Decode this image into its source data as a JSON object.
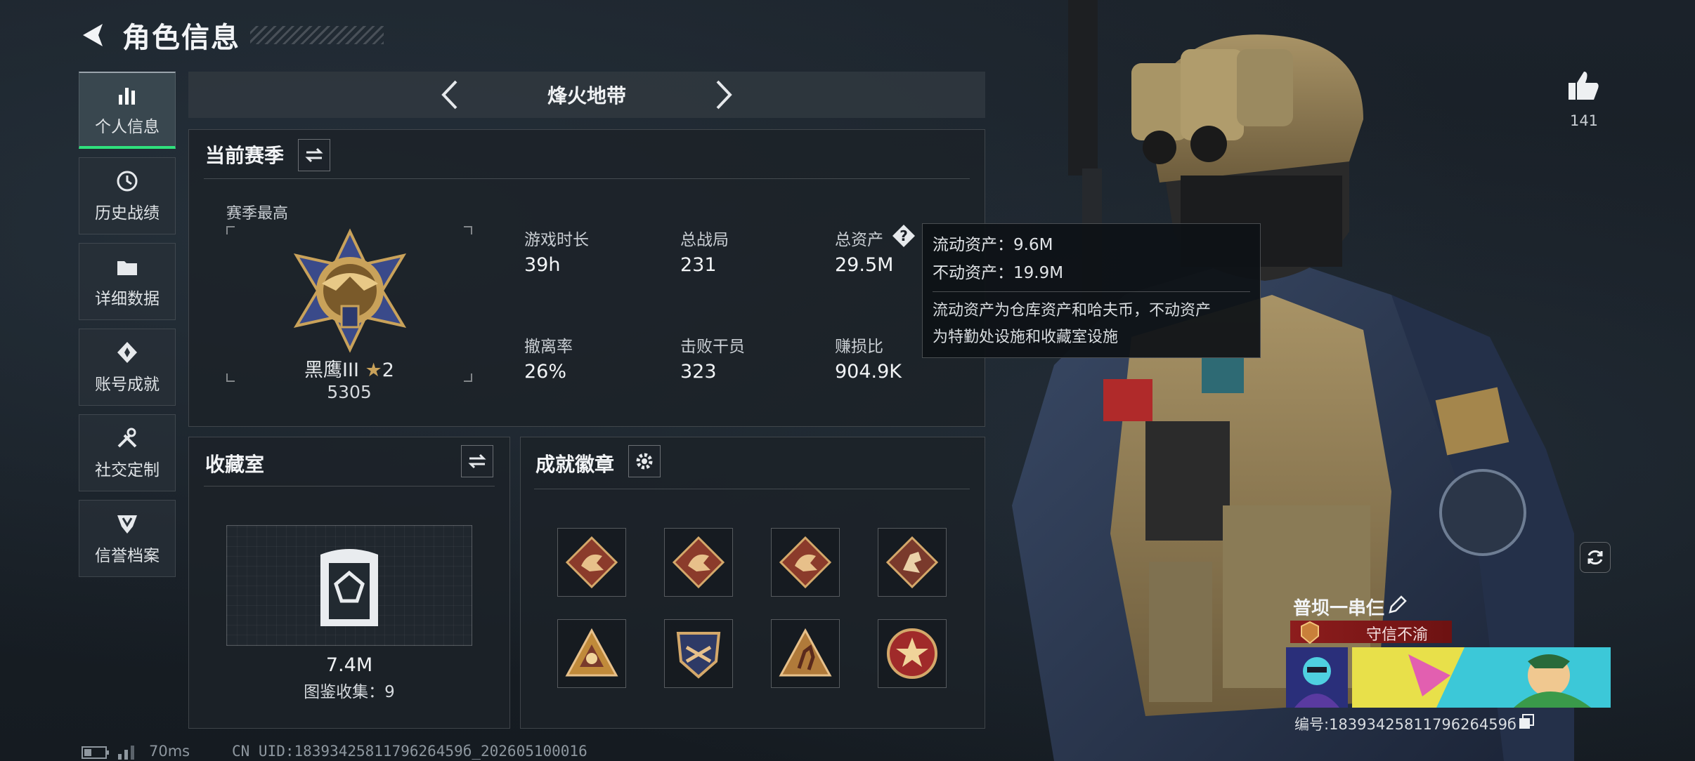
{
  "header": {
    "title": "角色信息"
  },
  "nav": {
    "items": [
      {
        "label": "个人信息",
        "active": true
      },
      {
        "label": "历史战绩"
      },
      {
        "label": "详细数据"
      },
      {
        "label": "账号成就"
      },
      {
        "label": "社交定制"
      },
      {
        "label": "信誉档案"
      }
    ]
  },
  "mode": {
    "name": "烽火地带"
  },
  "season": {
    "title": "当前赛季",
    "best_label": "赛季最高",
    "rank_name": "黑鹰III",
    "rank_stars": "2",
    "rank_score": "5305",
    "stats": [
      {
        "label": "游戏时长",
        "value": "39h"
      },
      {
        "label": "总战局",
        "value": "231"
      },
      {
        "label": "总资产",
        "value": "29.5M"
      },
      {
        "label": "撤离率",
        "value": "26%"
      },
      {
        "label": "击败干员",
        "value": "323"
      },
      {
        "label": "赚损比",
        "value": "904.9K"
      }
    ]
  },
  "tooltip": {
    "line1": "流动资产：9.6M",
    "line2": "不动资产：19.9M",
    "desc1": "流动资产为仓库资产和哈夫币，不动资产",
    "desc2": "为特勤处设施和收藏室设施"
  },
  "collection": {
    "title": "收藏室",
    "value": "7.4M",
    "count": "图鉴收集：9"
  },
  "badges": {
    "title": "成就徽章",
    "items": [
      "dragon-badge",
      "dragon-badge",
      "dragon-badge",
      "climber-badge",
      "pyramid-badge",
      "shield-badge",
      "runner-badge",
      "star-badge"
    ]
  },
  "profile": {
    "likes": "141",
    "name": "普坝一串仨",
    "honor": "守信不渝",
    "id": "编号:1839342581179626459б"
  },
  "footer": {
    "ping": "70ms",
    "uid": "CN UID:1839342581179626459б_202605100016"
  },
  "colors": {
    "accent_green": "#2fe07c",
    "honor_red": "#8d1d1d",
    "gold": "#c9a25a"
  }
}
